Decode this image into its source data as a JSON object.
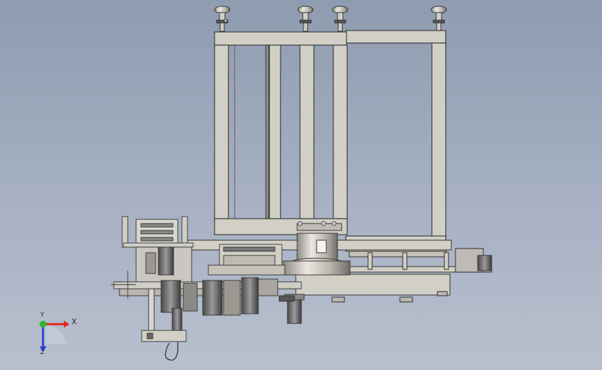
{
  "viewport": {
    "background_top": "#8f9bb0",
    "background_bottom": "#b8c0ce",
    "frame_fill": "#d2d0c6",
    "frame_stroke": "#3a3a3a"
  },
  "triad": {
    "x_label": "X",
    "y_label": "Y",
    "z_label": "Z",
    "x_color": "#e2231a",
    "y_color": "#2fb52f",
    "z_color": "#2a3fd8"
  }
}
